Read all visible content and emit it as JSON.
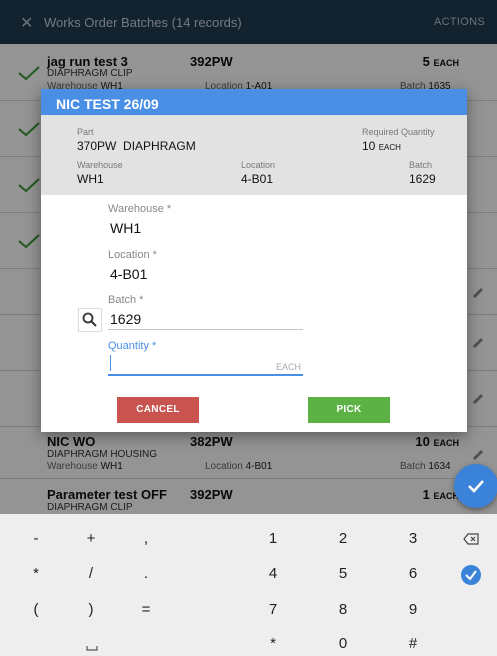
{
  "appbar": {
    "title": "Works Order Batches (14 records)",
    "actions": "ACTIONS"
  },
  "rows": [
    {
      "name": "jag run test 3",
      "desc": "DIAPHRAGM CLIP",
      "part": "392PW",
      "qty": "5",
      "uom": "EACH",
      "warehouse_label": "Warehouse",
      "warehouse": "WH1",
      "location_label": "Location",
      "location": "1-A01",
      "batch_label": "Batch",
      "batch": "1635"
    },
    {
      "name": "NIC WO",
      "desc": "DIAPHRAGM HOUSING",
      "part": "382PW",
      "qty": "10",
      "uom": "EACH",
      "warehouse_label": "Warehouse",
      "warehouse": "WH1",
      "location_label": "Location",
      "location": "4-B01",
      "batch_label": "Batch",
      "batch": "1634"
    },
    {
      "name": "Parameter test OFF",
      "desc": "DIAPHRAGM CLIP",
      "part": "392PW",
      "qty": "1",
      "uom": "EACH"
    }
  ],
  "dialog": {
    "title": "NIC TEST 26/09",
    "info": {
      "part_label": "Part",
      "part": "370PW",
      "part_desc": "DIAPHRAGM",
      "req_label": "Required Quantity",
      "req_qty": "10",
      "req_uom": "EACH",
      "warehouse_label": "Warehouse",
      "warehouse": "WH1",
      "location_label": "Location",
      "location": "4-B01",
      "batch_label": "Batch",
      "batch": "1629"
    },
    "form": {
      "warehouse_label": "Warehouse *",
      "warehouse": "WH1",
      "location_label": "Location *",
      "location": "4-B01",
      "batch_label": "Batch *",
      "batch": "1629",
      "quantity_label": "Quantity *",
      "quantity_placeholder": "",
      "quantity_uom": "EACH"
    },
    "cancel": "CANCEL",
    "pick": "PICK"
  },
  "keyboard": {
    "rows": [
      [
        "-",
        "+",
        ",",
        "1",
        "2",
        "3"
      ],
      [
        "*",
        "/",
        ".",
        "4",
        "5",
        "6"
      ],
      [
        "(",
        ")",
        "=",
        "7",
        "8",
        "9"
      ],
      [
        "",
        "",
        "",
        "*",
        "0",
        "#"
      ]
    ]
  },
  "colors": {
    "accent": "#4a8fe6",
    "cancel": "#c9534f",
    "pick": "#5cb244",
    "check": "#3a9a3a"
  }
}
